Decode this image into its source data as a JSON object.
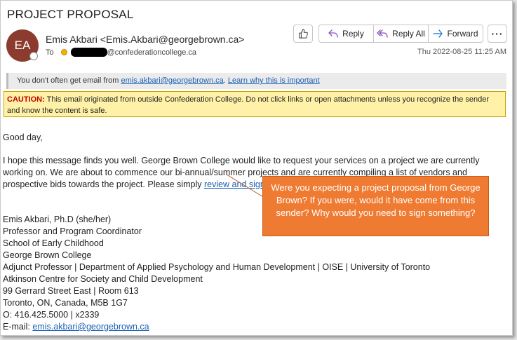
{
  "email": {
    "subject": "PROJECT PROPOSAL",
    "avatar_initials": "EA",
    "sender": "Emis Akbari <Emis.Akbari@georgebrown.ca>",
    "to_label": "To",
    "to_address_suffix": "@confederationcollege.ca",
    "date": "Thu 2022-08-25 11:25 AM"
  },
  "toolbar": {
    "reply_label": "Reply",
    "reply_all_label": "Reply All",
    "forward_label": "Forward",
    "more_label": "···"
  },
  "info_bar": {
    "prefix": "You don't often get email from ",
    "sender_link": "emis.akbari@georgebrown.ca",
    "separator": ". ",
    "learn_link": "Learn why this is important"
  },
  "caution": {
    "label": "CAUTION:",
    "text": " This email originated from outside Confederation College. Do not click links or open attachments unless you recognize the sender and know the content is safe."
  },
  "body": {
    "greeting": "Good day,",
    "paragraph": "I hope this message finds you well. George Brown College would like to request your services on a project we are currently working on. We are about to commence our bi-annual/summer projects and are currently compiling a list of vendors and prospective bids towards the project. Please simply ",
    "link": "review and sign"
  },
  "signature": {
    "lines": [
      "Emis Akbari, Ph.D (she/her)",
      "Professor and Program Coordinator",
      "School of Early Childhood",
      "George Brown College",
      "Adjunct Professor | Department of Applied Psychology and Human Development | OISE | University of Toronto",
      "Atkinson Centre for Society and Child Development",
      "99 Gerrard Street East | Room 613",
      "Toronto, ON, Canada, M5B 1G7",
      "O: 416.425.5000 | x2339"
    ],
    "email_label": "E-mail: ",
    "email_link": "emis.akbari@georgebrown.ca"
  },
  "callout": {
    "text": "Were you expecting a project proposal from George Brown? If you were, would it have come from this sender? Why would you need to sign something?"
  },
  "colors": {
    "avatar": "#8b3c2e",
    "callout": "#ef7b32",
    "link": "#1a5fb4",
    "caution_bg": "#fff2a8",
    "caution_label": "#c00000",
    "reply_icon": "#8a4fc0",
    "forward_icon": "#1a73c9"
  },
  "icons": {
    "like": "thumbs-up-icon",
    "reply": "reply-arrow-icon",
    "reply_all": "reply-all-arrow-icon",
    "forward": "forward-arrow-icon",
    "more": "more-icon"
  }
}
